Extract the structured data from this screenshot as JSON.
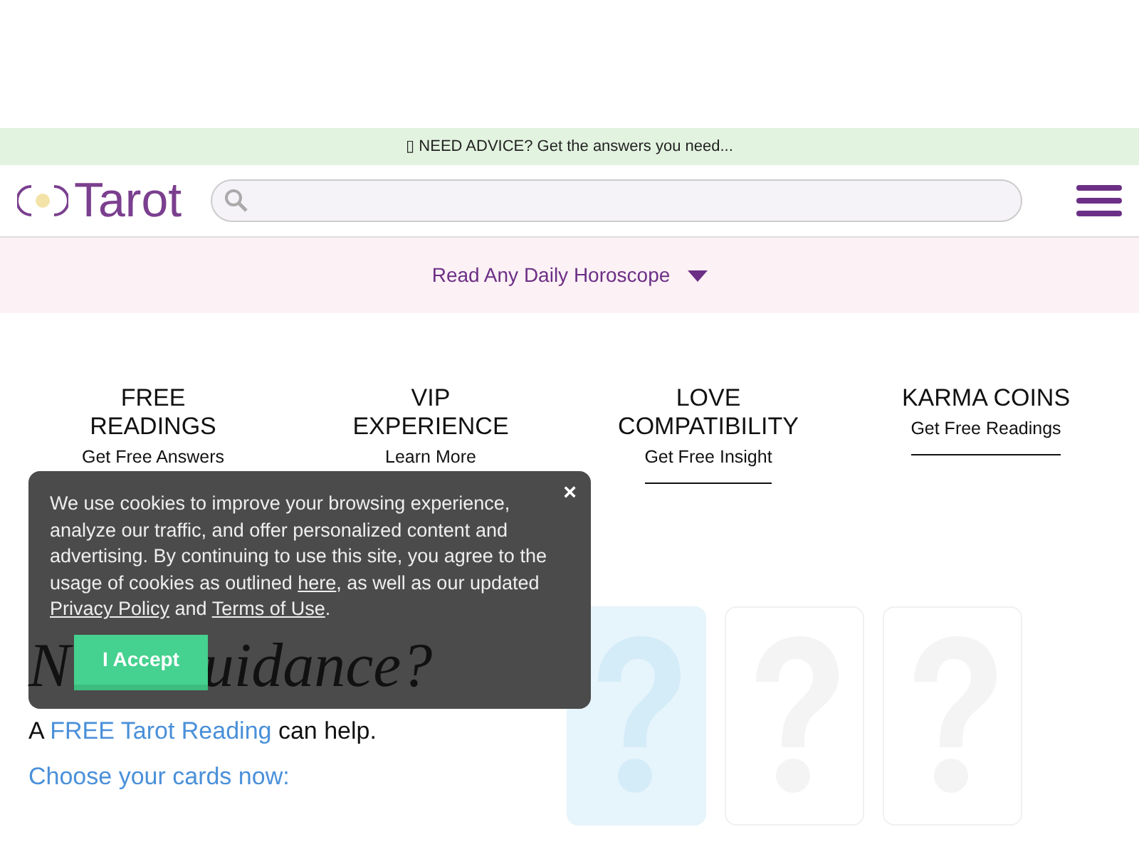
{
  "banner": {
    "text": "▯ NEED ADVICE? Get the answers you need..."
  },
  "header": {
    "logo_text": "Tarot"
  },
  "horoscope_bar": {
    "label": "Read Any Daily Horoscope"
  },
  "features": [
    {
      "title": "FREE READINGS",
      "link": "Get Free Answers"
    },
    {
      "title": "VIP EXPERIENCE",
      "link": "Learn More"
    },
    {
      "title": "LOVE COMPATIBILITY",
      "link": "Get Free Insight"
    },
    {
      "title": "KARMA COINS",
      "link": "Get Free Readings"
    }
  ],
  "hero": {
    "heading_start": "N",
    "heading_end": "uidance?",
    "line_prefix": "A ",
    "line_link": "FREE Tarot Reading",
    "line_suffix": " can help.",
    "prompt": "Choose your cards now:"
  },
  "cards": [
    {
      "selected": true
    },
    {
      "selected": false
    },
    {
      "selected": false
    }
  ],
  "cookie_notice": {
    "text_1": "We use cookies to improve your browsing experience, analyze our traffic, and offer personalized content and advertising. By continuing to use this site, you agree to the usage of cookies as outlined ",
    "link_1": "here",
    "text_2": ", as well as our updated ",
    "link_2": "Privacy Policy",
    "text_3": " and ",
    "link_3": "Terms of Use",
    "text_4": ".",
    "close": "×",
    "accept": "I Accept"
  }
}
